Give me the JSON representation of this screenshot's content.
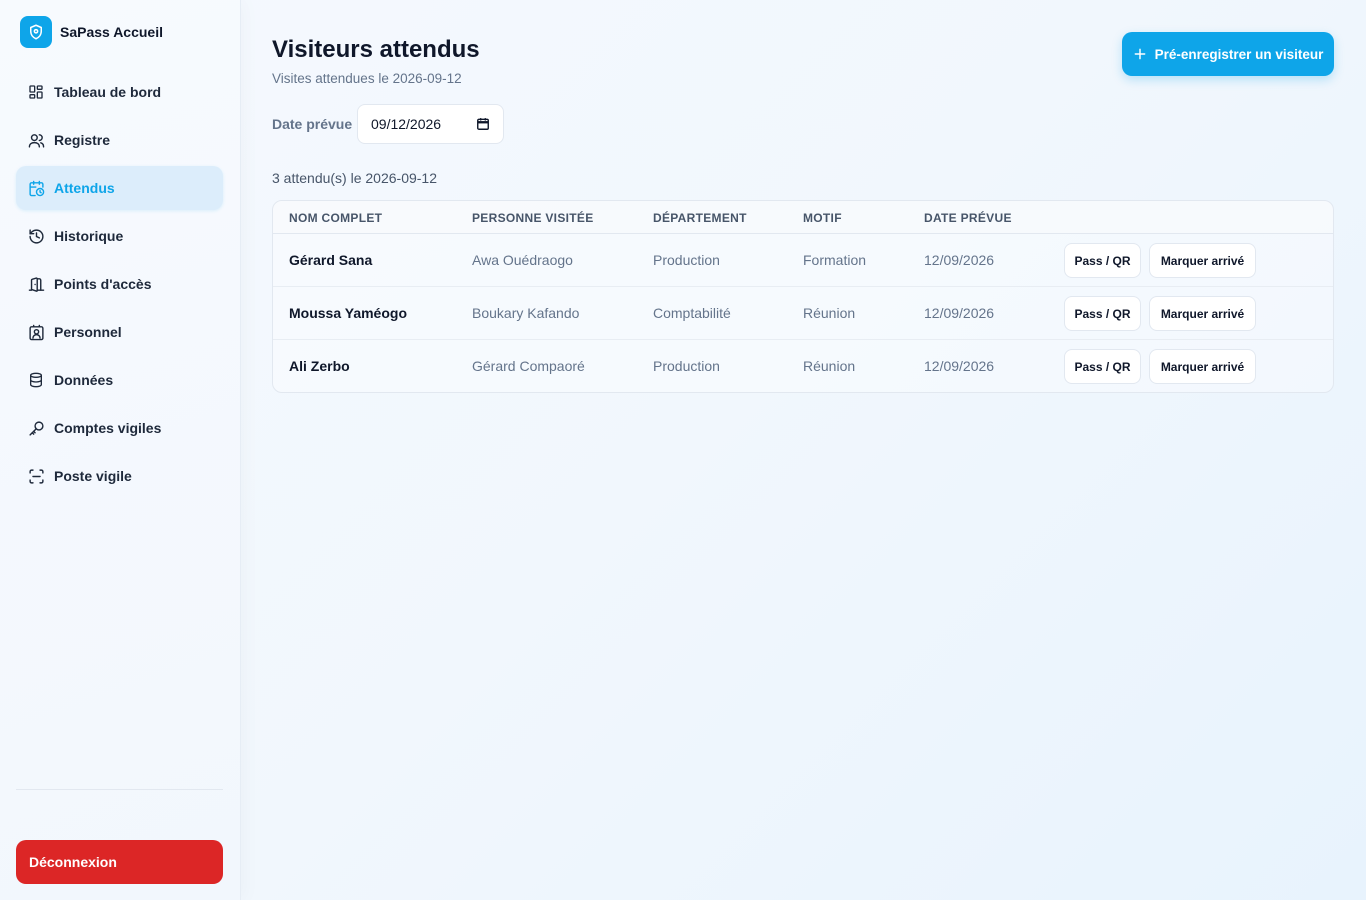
{
  "brand": {
    "name": "SaPass Accueil",
    "icon": "shield-icon"
  },
  "sidebar": {
    "items": [
      {
        "label": "Tableau de bord",
        "icon": "grid-icon",
        "active": false
      },
      {
        "label": "Registre",
        "icon": "users-icon",
        "active": false
      },
      {
        "label": "Attendus",
        "icon": "calendar-clock-icon",
        "active": true
      },
      {
        "label": "Historique",
        "icon": "history-icon",
        "active": false
      },
      {
        "label": "Points d'accès",
        "icon": "door-icon",
        "active": false
      },
      {
        "label": "Personnel",
        "icon": "badge-icon",
        "active": false
      },
      {
        "label": "Données",
        "icon": "database-icon",
        "active": false
      },
      {
        "label": "Comptes vigiles",
        "icon": "key-icon",
        "active": false
      },
      {
        "label": "Poste vigile",
        "icon": "scan-icon",
        "active": false
      }
    ],
    "logout_label": "Déconnexion"
  },
  "header": {
    "title": "Visiteurs attendus",
    "subtitle": "Visites attendues le 2026-09-12",
    "prereg_label": "Pré-enregistrer un visiteur"
  },
  "filter": {
    "date_label": "Date prévue",
    "date_value": "09/12/2026"
  },
  "count_text": "3 attendu(s) le 2026-09-12",
  "table": {
    "columns": [
      "NOM COMPLET",
      "PERSONNE VISITÉE",
      "DÉPARTEMENT",
      "MOTIF",
      "DATE PRÉVUE"
    ],
    "rows": [
      {
        "name": "Gérard Sana",
        "visited": "Awa Ouédraogo",
        "department": "Production",
        "reason": "Formation",
        "date": "12/09/2026",
        "pass_label": "Pass / QR",
        "arrive_label": "Marquer arrivé"
      },
      {
        "name": "Moussa Yaméogo",
        "visited": "Boukary Kafando",
        "department": "Comptabilité",
        "reason": "Réunion",
        "date": "12/09/2026",
        "pass_label": "Pass / QR",
        "arrive_label": "Marquer arrivé"
      },
      {
        "name": "Ali Zerbo",
        "visited": "Gérard Compaoré",
        "department": "Production",
        "reason": "Réunion",
        "date": "12/09/2026",
        "pass_label": "Pass / QR",
        "arrive_label": "Marquer arrivé"
      }
    ]
  },
  "colors": {
    "accent": "#0ea5e9",
    "active_bg": "#dcedfb",
    "danger": "#dc2626",
    "text": "#0f172a",
    "muted": "#64748b"
  }
}
